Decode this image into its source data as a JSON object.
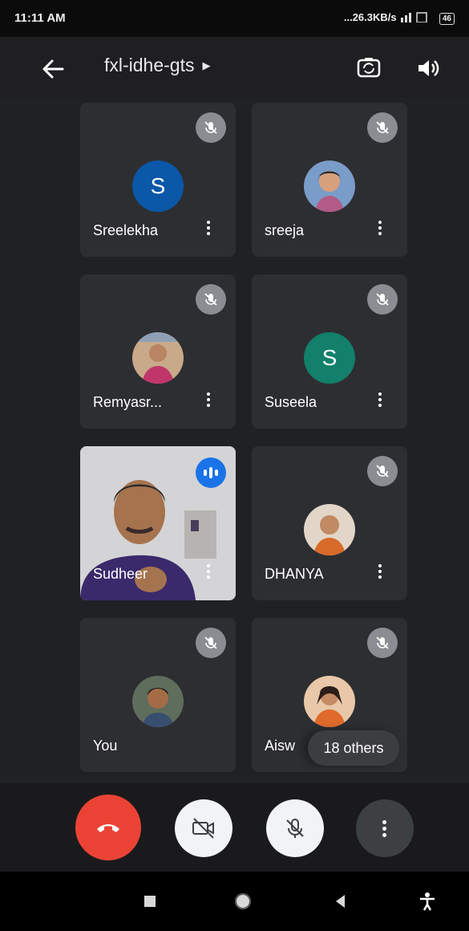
{
  "status_bar": {
    "time": "11:11 AM",
    "network_speed": "...26.3KB/s",
    "battery": "46"
  },
  "header": {
    "meeting_code": "fxl-idhe-gts",
    "icons": [
      "back-arrow-icon",
      "chevron-right-icon",
      "switch-camera-icon",
      "speaker-icon"
    ]
  },
  "participants": [
    {
      "name": "Sreelekha",
      "avatar_letter": "S",
      "avatar_color": "#0b57a8",
      "muted": true
    },
    {
      "name": "sreeja",
      "avatar_letter": "",
      "muted": true
    },
    {
      "name": "Remyasr...",
      "avatar_letter": "",
      "muted": true
    },
    {
      "name": "Suseela",
      "avatar_letter": "S",
      "avatar_color": "#12806a",
      "muted": true
    },
    {
      "name": "Sudheer",
      "avatar_letter": "",
      "muted": false,
      "speaking": true,
      "video_on": true
    },
    {
      "name": "DHANYA",
      "avatar_letter": "",
      "muted": true
    },
    {
      "name": "You",
      "avatar_letter": "",
      "muted": true
    },
    {
      "name": "Aisw",
      "avatar_letter": "",
      "muted": true
    }
  ],
  "others_label": "18 others",
  "controls": {
    "icons": [
      "end-call-icon",
      "camera-off-icon",
      "mic-off-icon",
      "more-vert-icon"
    ],
    "end_call_color": "#ea4335"
  },
  "nav": {
    "icons": [
      "recents-square-icon",
      "home-circle-icon",
      "back-triangle-icon",
      "accessibility-icon"
    ]
  }
}
